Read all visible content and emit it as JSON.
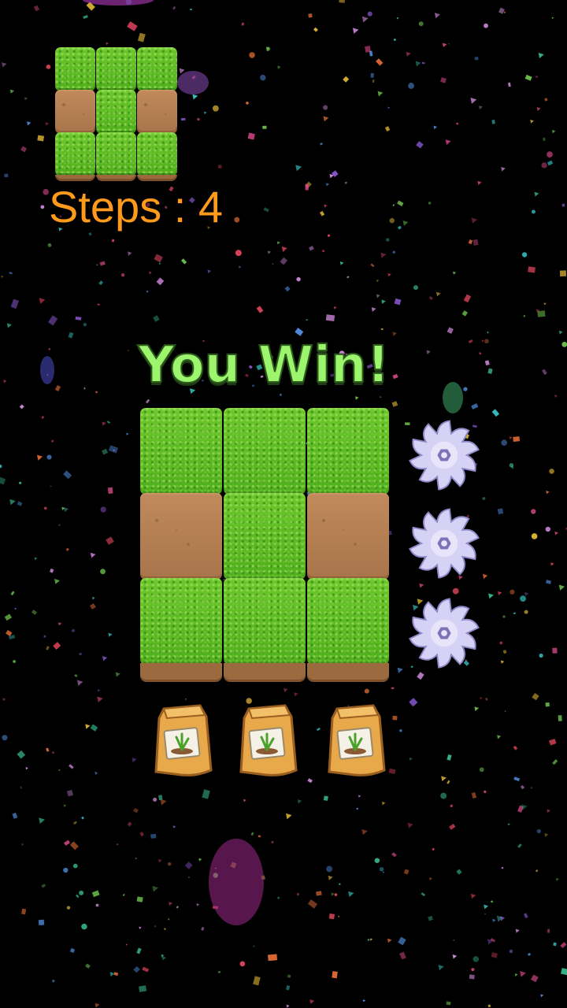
{
  "steps_label": "Steps : 4",
  "win_label": "You Win!",
  "grid": [
    [
      "grass",
      "grass",
      "grass"
    ],
    [
      "dirt",
      "grass",
      "dirt"
    ],
    [
      "grass",
      "grass",
      "grass"
    ]
  ],
  "row_cutters": [
    "saw-blade-icon",
    "saw-blade-icon",
    "saw-blade-icon"
  ],
  "column_seeds": [
    "seed-bag-icon",
    "seed-bag-icon",
    "seed-bag-icon"
  ],
  "colors": {
    "background": "#000000",
    "steps_text": "#ff9a1c",
    "win_text": "#9cf56d",
    "grass": "#55b41f",
    "dirt": "#b07c50",
    "saw": "#d6d2f5"
  }
}
